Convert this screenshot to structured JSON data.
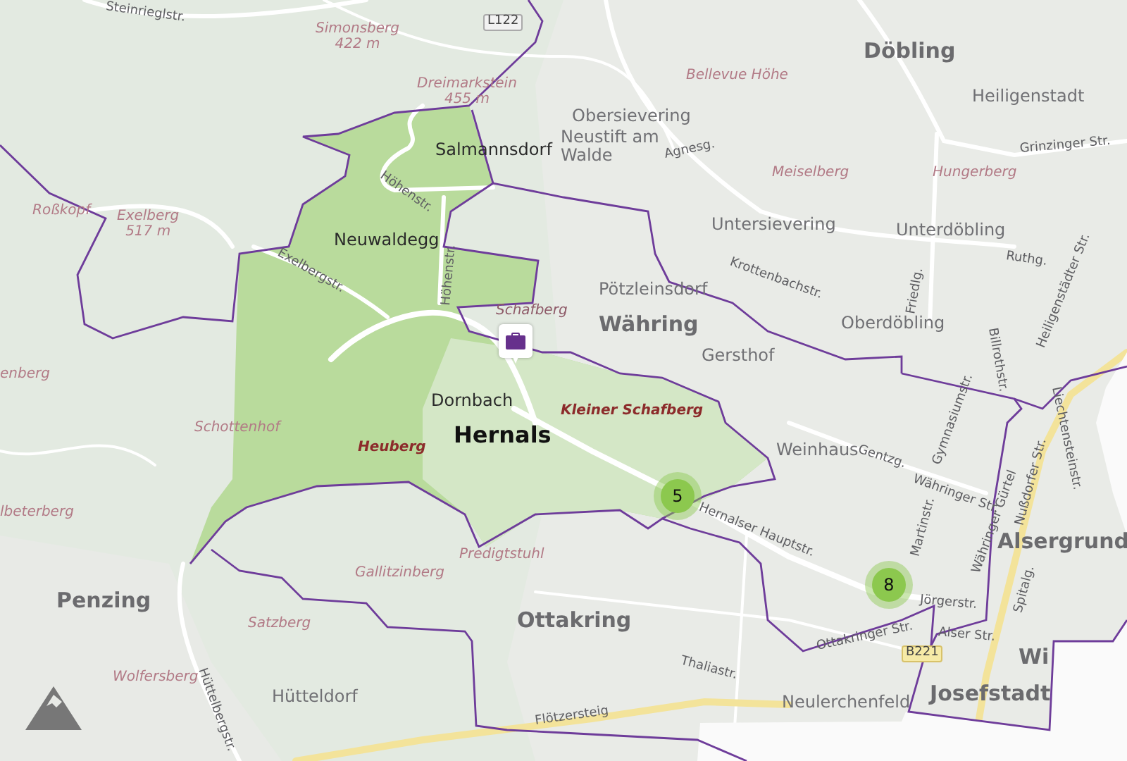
{
  "map": {
    "labels": [
      {
        "kind": "district",
        "text": "Döbling"
      },
      {
        "kind": "district",
        "text": "Währing"
      },
      {
        "kind": "focus_district",
        "text": "Hernals"
      },
      {
        "kind": "district",
        "text": "Penzing"
      },
      {
        "kind": "district",
        "text": "Ottakring"
      },
      {
        "kind": "district",
        "text": "Alsergrund"
      },
      {
        "kind": "district",
        "text": "Wi"
      },
      {
        "kind": "district",
        "text": "Josefstadt"
      },
      {
        "kind": "locality",
        "text": "Salmannsdorf"
      },
      {
        "kind": "locality",
        "text": "Neuwaldegg"
      },
      {
        "kind": "locality",
        "text": "Dornbach"
      },
      {
        "kind": "locality",
        "text": "Obersievering"
      },
      {
        "kind": "locality",
        "text": "Neustift am Walde"
      },
      {
        "kind": "locality",
        "text": "Untersievering"
      },
      {
        "kind": "locality",
        "text": "Pötzleinsdorf"
      },
      {
        "kind": "locality",
        "text": "Gersthof"
      },
      {
        "kind": "locality",
        "text": "Heiligenstadt"
      },
      {
        "kind": "locality",
        "text": "Unterdöbling"
      },
      {
        "kind": "locality",
        "text": "Oberdöbling"
      },
      {
        "kind": "locality",
        "text": "Weinhaus"
      },
      {
        "kind": "locality",
        "text": "Hütteldorf"
      },
      {
        "kind": "locality",
        "text": "Neulerchenfeld"
      },
      {
        "kind": "peak",
        "text": "Simonsberg",
        "elevation": "422 m"
      },
      {
        "kind": "peak",
        "text": "Dreimarkstein",
        "elevation": "455 m"
      },
      {
        "kind": "peak",
        "text": "Roßkopf"
      },
      {
        "kind": "peak",
        "text": "Exelberg",
        "elevation": "517 m"
      },
      {
        "kind": "peak",
        "text": "Bellevue Höhe"
      },
      {
        "kind": "peak",
        "text": "Meiselberg"
      },
      {
        "kind": "peak",
        "text": "Hungerberg"
      },
      {
        "kind": "peak",
        "text": "Schafberg"
      },
      {
        "kind": "landmark",
        "text": "Kleiner Schafberg"
      },
      {
        "kind": "landmark",
        "text": "Heuberg"
      },
      {
        "kind": "peak",
        "text": "Schottenhof"
      },
      {
        "kind": "peak",
        "text": "Predigtstuhl"
      },
      {
        "kind": "peak",
        "text": "Gallitzinberg"
      },
      {
        "kind": "peak",
        "text": "Satzberg"
      },
      {
        "kind": "peak",
        "text": "Wolfersberg"
      },
      {
        "kind": "peak",
        "text": "enberg"
      },
      {
        "kind": "peak",
        "text": "lbeterberg"
      },
      {
        "kind": "street",
        "text": "Steinrieglstr."
      },
      {
        "kind": "street",
        "text": "Höhenstr."
      },
      {
        "kind": "street",
        "text": "Höhenstr."
      },
      {
        "kind": "street",
        "text": "Exelbergstr."
      },
      {
        "kind": "street",
        "text": "Agnesg."
      },
      {
        "kind": "street",
        "text": "Krottenbachstr."
      },
      {
        "kind": "street",
        "text": "Grinzinger Str."
      },
      {
        "kind": "street",
        "text": "Ruthg."
      },
      {
        "kind": "street",
        "text": "Friedlg."
      },
      {
        "kind": "street",
        "text": "Billrothstr."
      },
      {
        "kind": "street",
        "text": "Heiligenstädter Str."
      },
      {
        "kind": "street",
        "text": "Gentzg."
      },
      {
        "kind": "street",
        "text": "Währinger Str."
      },
      {
        "kind": "street",
        "text": "Gymnasiumstr."
      },
      {
        "kind": "street",
        "text": "Martinstr."
      },
      {
        "kind": "street",
        "text": "Hernalser Hauptstr."
      },
      {
        "kind": "street",
        "text": "Jörgerstr."
      },
      {
        "kind": "street",
        "text": "Ottakringer Str."
      },
      {
        "kind": "street",
        "text": "Alser Str."
      },
      {
        "kind": "street",
        "text": "Thaliastr."
      },
      {
        "kind": "street",
        "text": "Flötzersteig"
      },
      {
        "kind": "street",
        "text": "Hüttelbergstr."
      },
      {
        "kind": "street",
        "text": "Währinger Gürtel"
      },
      {
        "kind": "street",
        "text": "Nußdorfer Str."
      },
      {
        "kind": "street",
        "text": "Liechtensteinstr."
      },
      {
        "kind": "street",
        "text": "Spitalg."
      },
      {
        "kind": "road_number",
        "text": "L122"
      },
      {
        "kind": "road_number",
        "text": "B221"
      }
    ],
    "clusters": [
      {
        "count": "5"
      },
      {
        "count": "8"
      }
    ],
    "pins": [
      {
        "kind": "briefcase"
      }
    ]
  }
}
